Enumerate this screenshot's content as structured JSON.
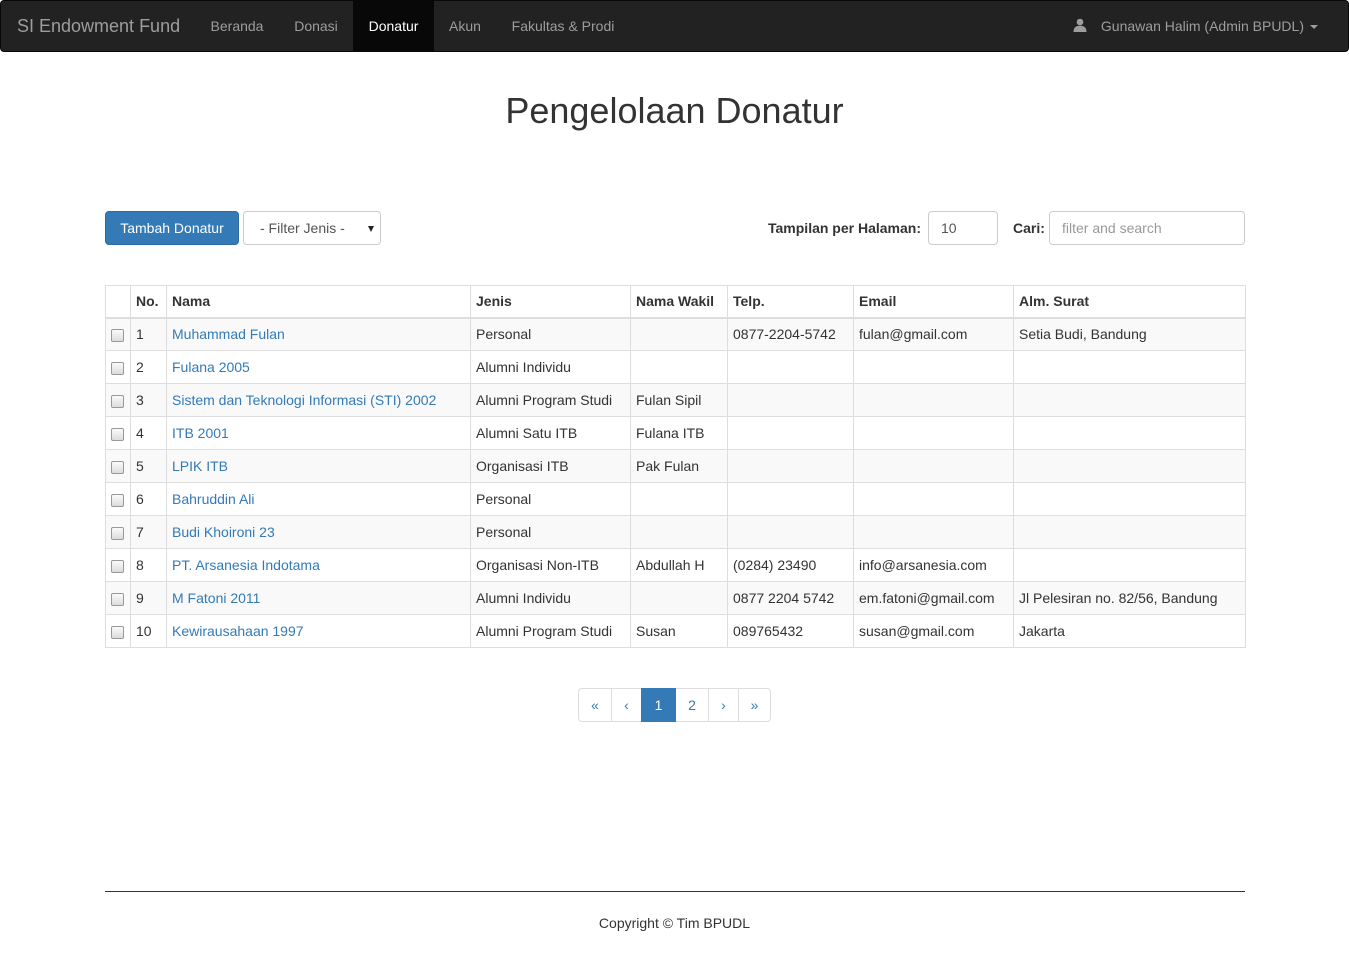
{
  "navbar": {
    "brand": "SI Endowment Fund",
    "items": [
      {
        "label": "Beranda"
      },
      {
        "label": "Donasi"
      },
      {
        "label": "Donatur"
      },
      {
        "label": "Akun"
      },
      {
        "label": "Fakultas & Prodi"
      }
    ],
    "active_item": "Donatur",
    "user": "Gunawan Halim (Admin BPUDL)"
  },
  "page": {
    "title": "Pengelolaan Donatur"
  },
  "toolbar": {
    "add_button": "Tambah Donatur",
    "filter_selected": "- Filter Jenis -",
    "per_page_label": "Tampilan per Halaman:",
    "per_page_value": "10",
    "search_label": "Cari:",
    "search_placeholder": "filter and search"
  },
  "table": {
    "columns": [
      "",
      "No.",
      "Nama",
      "Jenis",
      "Nama Wakil",
      "Telp.",
      "Email",
      "Alm. Surat"
    ],
    "rows": [
      {
        "no": "1",
        "nama": "Muhammad Fulan",
        "jenis": "Personal",
        "wakil": "",
        "telp": "0877-2204-5742",
        "email": "fulan@gmail.com",
        "alamat": "Setia Budi, Bandung"
      },
      {
        "no": "2",
        "nama": "Fulana 2005",
        "jenis": "Alumni Individu",
        "wakil": "",
        "telp": "",
        "email": "",
        "alamat": ""
      },
      {
        "no": "3",
        "nama": "Sistem dan Teknologi Informasi (STI) 2002",
        "jenis": "Alumni Program Studi",
        "wakil": "Fulan Sipil",
        "telp": "",
        "email": "",
        "alamat": ""
      },
      {
        "no": "4",
        "nama": "ITB 2001",
        "jenis": "Alumni Satu ITB",
        "wakil": "Fulana ITB",
        "telp": "",
        "email": "",
        "alamat": ""
      },
      {
        "no": "5",
        "nama": "LPIK ITB",
        "jenis": "Organisasi ITB",
        "wakil": "Pak Fulan",
        "telp": "",
        "email": "",
        "alamat": ""
      },
      {
        "no": "6",
        "nama": "Bahruddin Ali",
        "jenis": "Personal",
        "wakil": "",
        "telp": "",
        "email": "",
        "alamat": ""
      },
      {
        "no": "7",
        "nama": "Budi Khoironi 23",
        "jenis": "Personal",
        "wakil": "",
        "telp": "",
        "email": "",
        "alamat": ""
      },
      {
        "no": "8",
        "nama": "PT. Arsanesia Indotama",
        "jenis": "Organisasi Non-ITB",
        "wakil": "Abdullah H",
        "telp": "(0284) 23490",
        "email": "info@arsanesia.com",
        "alamat": ""
      },
      {
        "no": "9",
        "nama": "M Fatoni 2011",
        "jenis": "Alumni Individu",
        "wakil": "",
        "telp": "0877 2204 5742",
        "email": "em.fatoni@gmail.com",
        "alamat": "Jl Pelesiran no. 82/56, Bandung"
      },
      {
        "no": "10",
        "nama": "Kewirausahaan 1997",
        "jenis": "Alumni Program Studi",
        "wakil": "Susan",
        "telp": "089765432",
        "email": "susan@gmail.com",
        "alamat": "Jakarta"
      }
    ]
  },
  "pagination": {
    "items": [
      "«",
      "‹",
      "1",
      "2",
      "›",
      "»"
    ],
    "current_page": "1"
  },
  "footer": {
    "copyright": "Copyright © Tim BPUDL"
  },
  "colors": {
    "navbar_bg": "#222222",
    "active_nav_bg": "#080808",
    "primary": "#337ab7"
  }
}
